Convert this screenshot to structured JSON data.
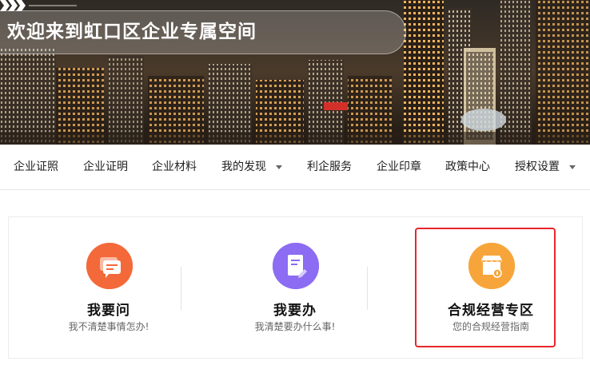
{
  "banner": {
    "title": "欢迎来到虹口区企业专属空间"
  },
  "nav": {
    "items": [
      {
        "label": "企业证照",
        "has_dropdown": false
      },
      {
        "label": "企业证明",
        "has_dropdown": false
      },
      {
        "label": "企业材料",
        "has_dropdown": false
      },
      {
        "label": "我的发现",
        "has_dropdown": true
      },
      {
        "label": "利企服务",
        "has_dropdown": false
      },
      {
        "label": "企业印章",
        "has_dropdown": false
      },
      {
        "label": "政策中心",
        "has_dropdown": false
      },
      {
        "label": "授权设置",
        "has_dropdown": true
      }
    ]
  },
  "services": [
    {
      "title": "我要问",
      "subtitle": "我不清楚事情怎办!",
      "icon": "chat-icon",
      "color": "#f4693a"
    },
    {
      "title": "我要办",
      "subtitle": "我清楚要办什么事!",
      "icon": "document-edit-icon",
      "color": "#8b6cf2"
    },
    {
      "title": "合规经营专区",
      "subtitle": "您的合规经营指南",
      "icon": "storefront-icon",
      "color": "#f7a53a"
    }
  ],
  "colors": {
    "highlight_border": "#e8262b",
    "nav_text": "#222222"
  }
}
